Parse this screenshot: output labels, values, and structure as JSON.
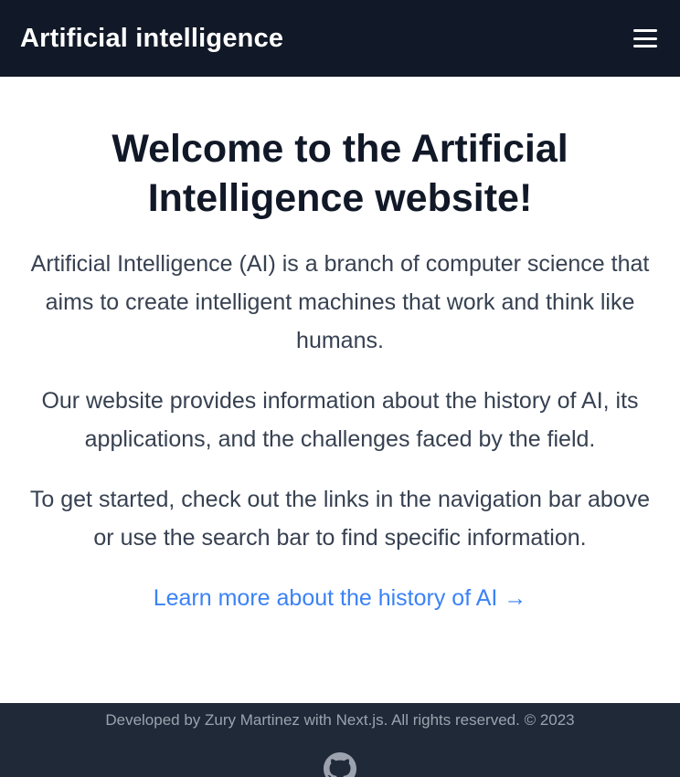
{
  "header": {
    "brand": "Artificial intelligence",
    "menu_icon": "hamburger-menu-icon"
  },
  "main": {
    "title": "Welcome to the Artificial Intelligence website!",
    "paragraphs": [
      "Artificial Intelligence (AI) is a branch of computer science that aims to create intelligent machines that work and think like humans.",
      "Our website provides information about the history of AI, its applications, and the challenges faced by the field.",
      "To get started, check out the links in the navigation bar above or use the search bar to find specific information."
    ],
    "link_label": "Learn more about the history of AI →"
  },
  "footer": {
    "text": "Developed by Zury Martinez with Next.js. All rights reserved. © 2023",
    "icon": "github-icon"
  },
  "colors": {
    "header_bg": "#111827",
    "footer_bg": "#1f2937",
    "link": "#3b82f6",
    "body_text": "#374151"
  }
}
